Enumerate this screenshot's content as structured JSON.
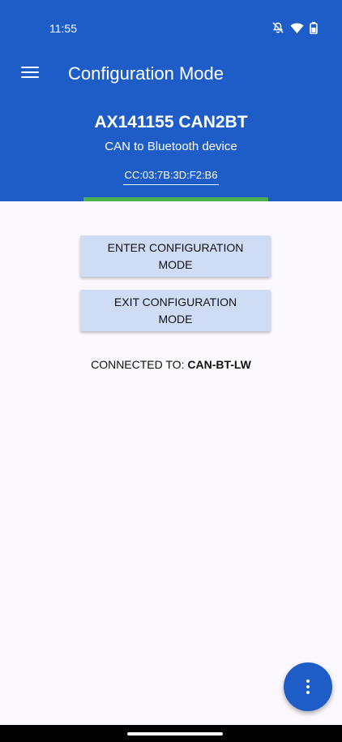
{
  "status_bar": {
    "time": "11:55",
    "icons": [
      "notifications-off-icon",
      "wifi-icon",
      "battery-icon"
    ]
  },
  "app_bar": {
    "title": "Configuration Mode",
    "menu_icon": "hamburger-menu-icon"
  },
  "device": {
    "name": "AX141155 CAN2BT",
    "description": "CAN to Bluetooth device",
    "mac_address": "CC:03:7B:3D:F2:B6"
  },
  "buttons": {
    "enter_label": "ENTER CONFIGURATION MODE",
    "exit_label": "EXIT CONFIGURATION MODE"
  },
  "connection": {
    "prefix": "CONNECTED TO:",
    "device": "CAN-BT-LW"
  },
  "fab": {
    "icon": "more-vert-icon"
  },
  "colors": {
    "primary": "#1e5dc8",
    "button_bg": "#cfdcf5",
    "connected_indicator": "#4caf50",
    "background": "#fbf8fd"
  }
}
